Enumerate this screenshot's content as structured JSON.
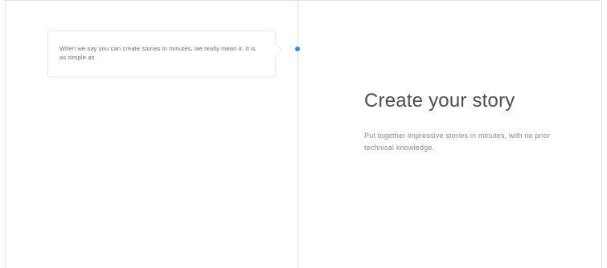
{
  "tooltip": {
    "text": "When we say you can create stories in minutes, we really mean it. It is as simple as"
  },
  "hero": {
    "title": "Create your story",
    "subtitle": "Put together impressive stories in minutes, with no prior technical knowledge."
  },
  "colors": {
    "accent": "#2b8ef0",
    "timeline": "#d6e7f7",
    "title": "#4f4f4f",
    "body": "#8a8a8a",
    "border": "#e3e3e3"
  }
}
